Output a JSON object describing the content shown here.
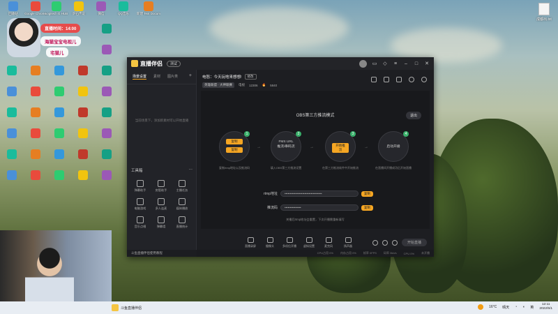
{
  "desktop": {
    "icons": [
      "回收站",
      "Google Chrome",
      "Logitech G HUB",
      "炉石传说",
      "微信",
      "QQ音乐",
      "新建 Text Document.txt",
      "",
      "",
      "",
      "",
      "",
      "",
      "",
      "",
      "",
      "",
      "",
      "",
      "",
      "",
      "",
      "",
      "",
      "",
      "",
      "",
      "",
      "",
      "",
      "",
      "",
      "",
      "",
      "",
      "",
      "",
      "",
      "",
      "",
      "",
      "",
      "",
      "",
      "",
      "",
      "",
      "",
      "",
      "",
      "",
      "",
      "",
      "",
      "",
      "",
      ""
    ],
    "top_icons": [
      "回收站",
      "Google Chrome",
      "Logitech G HUB",
      "炉石传说",
      "微信",
      "QQ音乐",
      "新建 Text Document.txt"
    ],
    "top_right_icon": "成都出.txt"
  },
  "overlay": {
    "live_time": "直播时间：14:00",
    "room_name": "海猫宝宝电视儿",
    "user_name": "宅猫儿"
  },
  "app": {
    "name": "直播伴侣",
    "version": "测试",
    "accent": "#f5a623",
    "sidebar": {
      "tabs": [
        "场景设置",
        "素材",
        "图片类"
      ],
      "empty_hint": "当前场景下，添加新素材可以开始直播",
      "tools_title": "工具箱",
      "tools": [
        {
          "label": "弹幕助手",
          "icon": "danmaku-icon"
        },
        {
          "label": "房管助手",
          "icon": "admin-icon"
        },
        {
          "label": "主播任务",
          "icon": "task-icon"
        },
        {
          "label": "电脑游戏",
          "icon": "pc-game-icon"
        },
        {
          "label": "多人连麦",
          "icon": "multi-mic-icon"
        },
        {
          "label": "媒体播放",
          "icon": "media-icon"
        },
        {
          "label": "音乐点唱",
          "icon": "music-icon"
        },
        {
          "label": "弹幕墙",
          "icon": "wall-icon"
        },
        {
          "label": "直播统计",
          "icon": "stats-icon"
        }
      ],
      "bottom_text": "斗鱼直播伴侣使用教程"
    },
    "stream": {
      "title": "电怒：今天玩啥来想想!",
      "edit_label": "修改",
      "category": "英雄联盟 · 大神联赛",
      "room_label": "电视",
      "room_id": "12306",
      "hot": "5840"
    },
    "panel": {
      "title": "OBS第三方推流模式",
      "exit_label": "退出",
      "steps": [
        {
          "num": "1",
          "lines": [
            "复制",
            "复制"
          ],
          "caption": "复制rtmp地址以及推流码"
        },
        {
          "num": "2",
          "lines": [
            "FMS URL",
            "推流/串码流"
          ],
          "caption": "填入OBS第三方推流设置"
        },
        {
          "num": "3",
          "lines": [
            "开始推流"
          ],
          "caption": "在第三方推流软件中开始推流"
        },
        {
          "num": "4",
          "lines": [
            "启动开播"
          ],
          "caption": "在直播间开播成功后开始直播"
        }
      ],
      "rtmp_label": "rtmp地址",
      "rtmp_value": "••••••••••••••••••••••••••••••••••",
      "key_label": "推流码",
      "key_value": "•••••••••••••••",
      "copy_label": "复制",
      "note": "关播后rtmp地址会重置，下次开播需重新填写"
    },
    "bottom_tools": [
      "直播录屏",
      "摄像头",
      "多机位开播",
      "虚拟设置",
      "麦克风",
      "扬声器"
    ],
    "start_label": "开始直播",
    "status": [
      "CPU占用 0%",
      "内存占用 0%",
      "帧率 0FPS",
      "码率 0kb/s",
      "CPU 0%",
      "未开播"
    ]
  },
  "taskbar": {
    "app_label": "斗鱼直播伴侣",
    "temperature": "16°C",
    "weather": "晴天",
    "time": "12:11",
    "date": "2022/5/1"
  }
}
